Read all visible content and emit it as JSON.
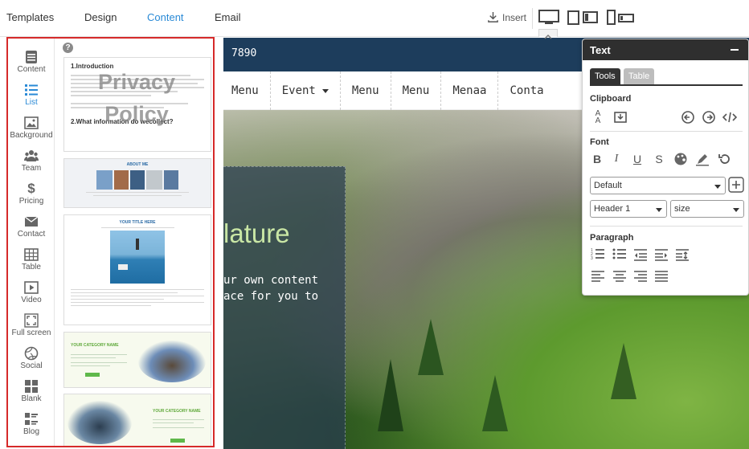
{
  "topbar": {
    "tabs": [
      "Templates",
      "Design",
      "Content",
      "Email"
    ],
    "active_tab": "Content",
    "insert_label": "Insert",
    "accent_color": "#2a8ad6"
  },
  "canvas": {
    "phone": "7890",
    "nav": [
      "Menu",
      "Event",
      "Menu",
      "Menu",
      "Menaa",
      "Conta"
    ],
    "hero_title": "lature",
    "hero_body": "ur own content\nace for you to"
  },
  "left_panel": {
    "categories": [
      "Content",
      "List",
      "Background",
      "Team",
      "Pricing",
      "Contact",
      "Table",
      "Video",
      "Full screen",
      "Social",
      "Blank",
      "Blog"
    ],
    "active_category": "List",
    "border_color": "#d62a2a",
    "thumbs": {
      "t1": {
        "heading1": "1.Introduction",
        "overlay_line1": "Privacy",
        "overlay_line2": "Policy",
        "heading2": "2.What information do wecollect?"
      },
      "t2": {
        "title": "ABOUT ME"
      },
      "t3": {
        "title": "YOUR TITLE HERE"
      },
      "t4": {
        "title": "YOUR CATEGORY NAME"
      },
      "t5": {
        "title": "YOUR CATEGORY NAME"
      }
    }
  },
  "text_panel": {
    "title": "Text",
    "tabs": [
      "Tools",
      "Table"
    ],
    "sections": {
      "clipboard": "Clipboard",
      "font": "Font",
      "paragraph": "Paragraph"
    },
    "font_family_value": "Default",
    "heading_value": "Header 1",
    "size_value": "size"
  }
}
